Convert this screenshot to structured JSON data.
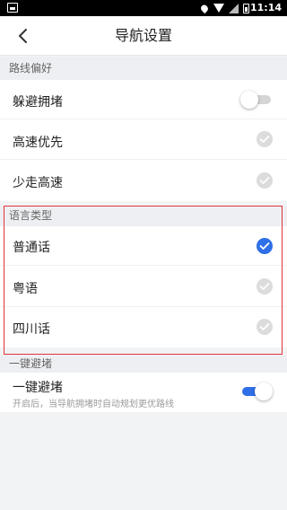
{
  "status_bar": {
    "time": "11:14",
    "icons": [
      "notification-icon",
      "location-icon",
      "wifi-icon",
      "signal-icon",
      "battery-icon"
    ]
  },
  "header": {
    "title": "导航设置",
    "back_icon": "chevron-left-icon"
  },
  "sections": {
    "route_pref": {
      "header": "路线偏好",
      "items": [
        {
          "label": "躲避拥堵",
          "control": "toggle",
          "on": false
        },
        {
          "label": "高速优先",
          "control": "check",
          "checked": false
        },
        {
          "label": "少走高速",
          "control": "check",
          "checked": false
        }
      ]
    },
    "language": {
      "header": "语言类型",
      "items": [
        {
          "label": "普通话",
          "checked": true
        },
        {
          "label": "粤语",
          "checked": false
        },
        {
          "label": "四川话",
          "checked": false
        }
      ]
    },
    "one_key": {
      "header": "一键避堵",
      "item": {
        "label": "一键避堵",
        "sublabel": "开启后，当导航拥堵时自动规划更优路线",
        "on": true
      }
    }
  },
  "colors": {
    "accent": "#2f6fe8",
    "highlight_frame": "#e0353a",
    "check_off": "#dcdcdc"
  }
}
